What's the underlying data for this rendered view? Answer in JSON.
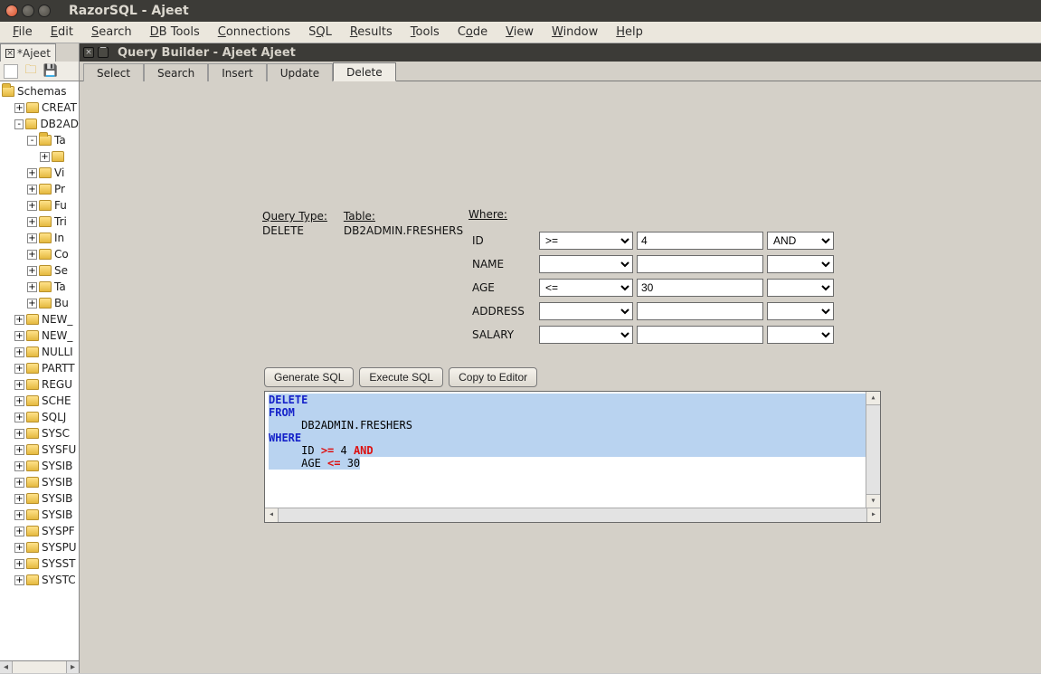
{
  "window": {
    "title": "RazorSQL - Ajeet"
  },
  "menu": [
    "File",
    "Edit",
    "Search",
    "DB Tools",
    "Connections",
    "SQL",
    "Results",
    "Tools",
    "Code",
    "View",
    "Window",
    "Help"
  ],
  "left_tab": {
    "label": "*Ajeet"
  },
  "tree": {
    "root": "Schemas",
    "items": [
      {
        "lvl": 1,
        "exp": "+",
        "label": "CREAT"
      },
      {
        "lvl": 1,
        "exp": "-",
        "label": "DB2AD"
      },
      {
        "lvl": 2,
        "exp": "-",
        "label": "Ta",
        "open": true
      },
      {
        "lvl": 3,
        "exp": "+",
        "label": ""
      },
      {
        "lvl": 2,
        "exp": "+",
        "label": "Vi"
      },
      {
        "lvl": 2,
        "exp": "+",
        "label": "Pr"
      },
      {
        "lvl": 2,
        "exp": "+",
        "label": "Fu"
      },
      {
        "lvl": 2,
        "exp": "+",
        "label": "Tri"
      },
      {
        "lvl": 2,
        "exp": "+",
        "label": "In"
      },
      {
        "lvl": 2,
        "exp": "+",
        "label": "Co"
      },
      {
        "lvl": 2,
        "exp": "+",
        "label": "Se"
      },
      {
        "lvl": 2,
        "exp": "+",
        "label": "Ta"
      },
      {
        "lvl": 2,
        "exp": "+",
        "label": "Bu"
      },
      {
        "lvl": 1,
        "exp": "+",
        "label": "NEW_"
      },
      {
        "lvl": 1,
        "exp": "+",
        "label": "NEW_"
      },
      {
        "lvl": 1,
        "exp": "+",
        "label": "NULLI"
      },
      {
        "lvl": 1,
        "exp": "+",
        "label": "PARTT"
      },
      {
        "lvl": 1,
        "exp": "+",
        "label": "REGU"
      },
      {
        "lvl": 1,
        "exp": "+",
        "label": "SCHE"
      },
      {
        "lvl": 1,
        "exp": "+",
        "label": "SQLJ"
      },
      {
        "lvl": 1,
        "exp": "+",
        "label": "SYSC"
      },
      {
        "lvl": 1,
        "exp": "+",
        "label": "SYSFU"
      },
      {
        "lvl": 1,
        "exp": "+",
        "label": "SYSIB"
      },
      {
        "lvl": 1,
        "exp": "+",
        "label": "SYSIB"
      },
      {
        "lvl": 1,
        "exp": "+",
        "label": "SYSIB"
      },
      {
        "lvl": 1,
        "exp": "+",
        "label": "SYSIB"
      },
      {
        "lvl": 1,
        "exp": "+",
        "label": "SYSPF"
      },
      {
        "lvl": 1,
        "exp": "+",
        "label": "SYSPU"
      },
      {
        "lvl": 1,
        "exp": "+",
        "label": "SYSST"
      },
      {
        "lvl": 1,
        "exp": "+",
        "label": "SYSTC"
      }
    ]
  },
  "inner_window": {
    "title": "Query Builder - Ajeet Ajeet"
  },
  "qb_tabs": [
    "Select",
    "Search",
    "Insert",
    "Update",
    "Delete"
  ],
  "qb_active_tab": "Delete",
  "query_info": {
    "headers": {
      "qtype": "Query Type:",
      "table": "Table:",
      "where": "Where:"
    },
    "qtype": "DELETE",
    "table": "DB2ADMIN.FRESHERS"
  },
  "where": {
    "rows": [
      {
        "col": "ID",
        "op": ">=",
        "val": "4",
        "conj": "AND"
      },
      {
        "col": "NAME",
        "op": "",
        "val": "",
        "conj": ""
      },
      {
        "col": "AGE",
        "op": "<=",
        "val": "30",
        "conj": ""
      },
      {
        "col": "ADDRESS",
        "op": "",
        "val": "",
        "conj": ""
      },
      {
        "col": "SALARY",
        "op": "",
        "val": "",
        "conj": ""
      }
    ]
  },
  "buttons": {
    "gen": "Generate SQL",
    "exec": "Execute SQL",
    "copy": "Copy to Editor"
  },
  "sql": {
    "l1": "DELETE",
    "l2": "FROM",
    "l3": "DB2ADMIN.FRESHERS",
    "l4": "WHERE",
    "l5a": "ID ",
    "l5op": ">=",
    "l5b": " 4  ",
    "l5and": "AND",
    "l6a": "AGE ",
    "l6op": "<=",
    "l6b": " 30"
  }
}
